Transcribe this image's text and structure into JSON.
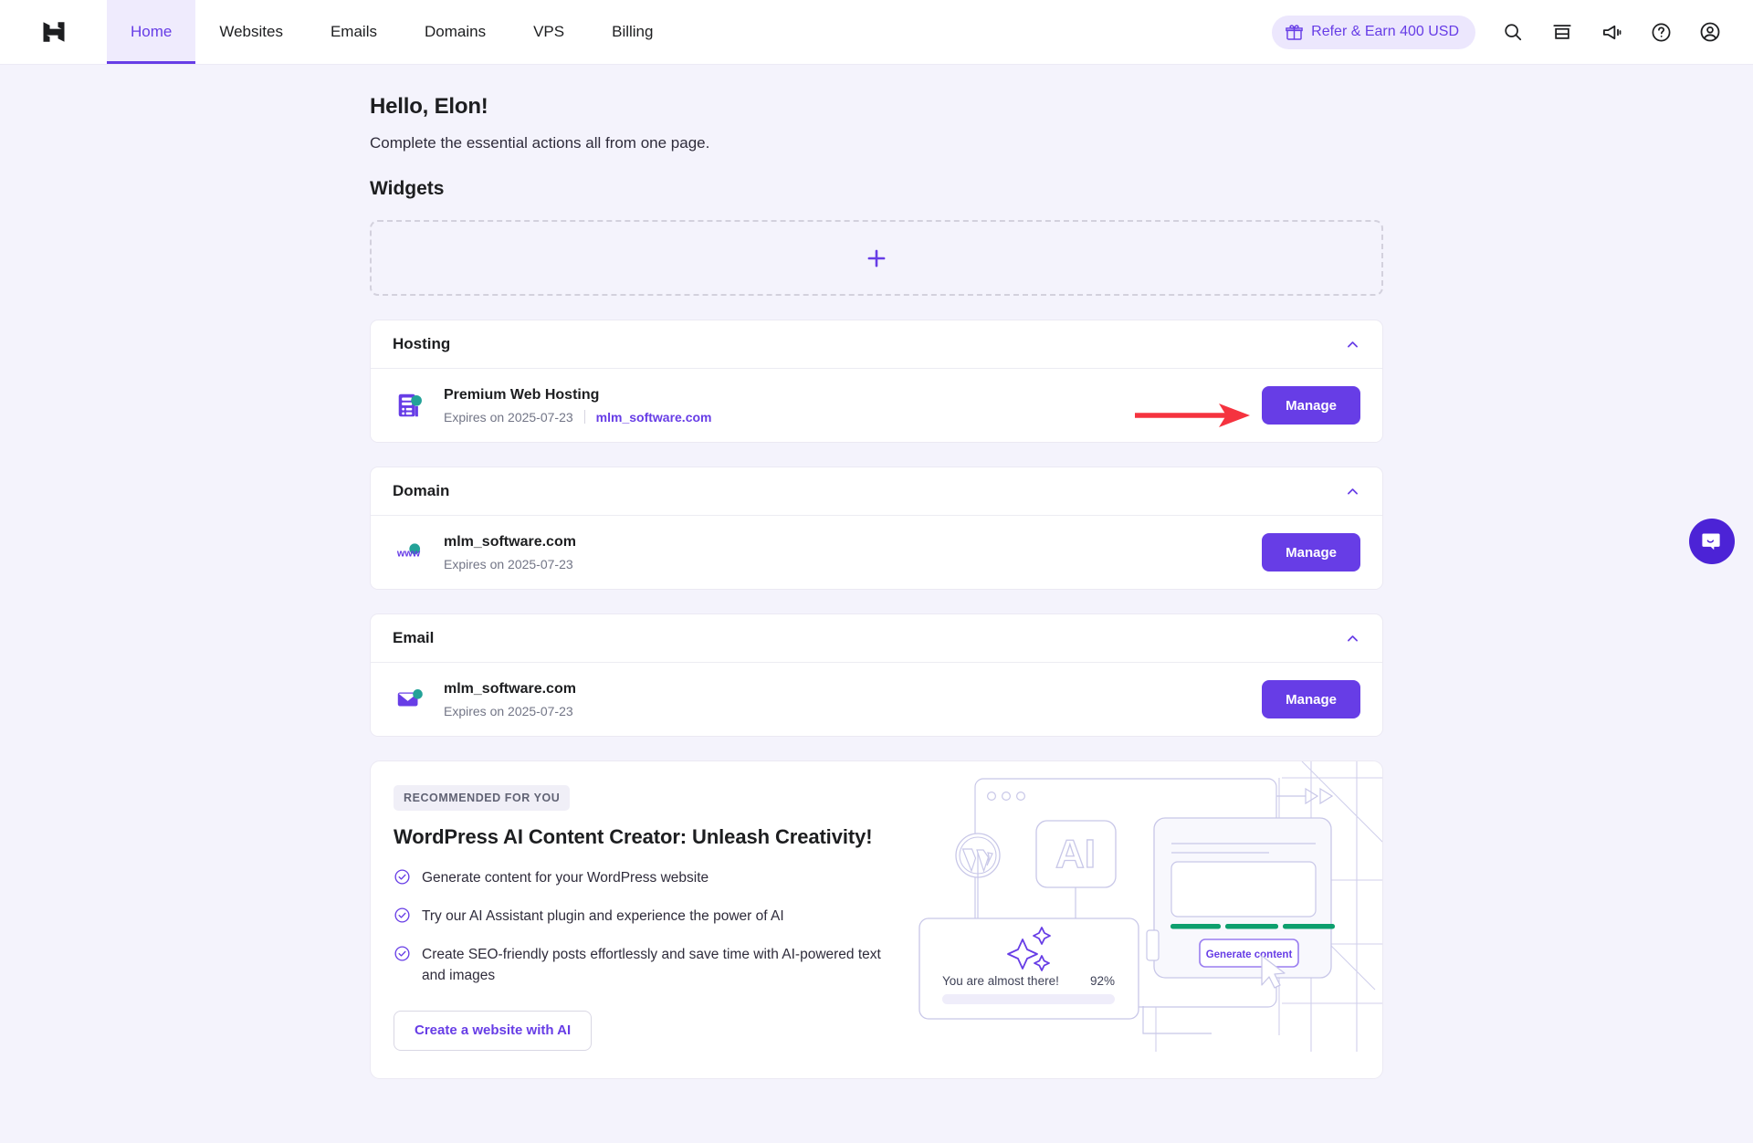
{
  "header": {
    "logo": "hostinger-logo",
    "nav": [
      {
        "label": "Home",
        "active": true
      },
      {
        "label": "Websites",
        "active": false
      },
      {
        "label": "Emails",
        "active": false
      },
      {
        "label": "Domains",
        "active": false
      },
      {
        "label": "VPS",
        "active": false
      },
      {
        "label": "Billing",
        "active": false
      }
    ],
    "refer": {
      "label": "Refer & Earn 400 USD",
      "icon": "gift-icon"
    },
    "icons": [
      "search-icon",
      "store-icon",
      "megaphone-icon",
      "help-icon",
      "account-icon"
    ]
  },
  "greeting": {
    "title": "Hello, Elon!",
    "subtitle": "Complete the essential actions all from one page."
  },
  "widgets": {
    "heading": "Widgets",
    "add_label": "+"
  },
  "sections": [
    {
      "key": "hosting",
      "title": "Hosting",
      "collapse_icon": "chevron-up-icon",
      "icon": "server-icon",
      "item_title": "Premium Web Hosting",
      "expires": "Expires on 2025-07-23",
      "domain": "mlm_software.com",
      "button": "Manage"
    },
    {
      "key": "domain",
      "title": "Domain",
      "collapse_icon": "chevron-up-icon",
      "icon": "www-icon",
      "item_title": "mlm_software.com",
      "expires": "Expires on 2025-07-23",
      "domain": "",
      "button": "Manage"
    },
    {
      "key": "email",
      "title": "Email",
      "collapse_icon": "chevron-up-icon",
      "icon": "envelope-icon",
      "item_title": "mlm_software.com",
      "expires": "Expires on 2025-07-23",
      "domain": "",
      "button": "Manage"
    }
  ],
  "recommended": {
    "badge": "RECOMMENDED FOR YOU",
    "title": "WordPress AI Content Creator: Unleash Creativity!",
    "bullets": [
      "Generate content for your WordPress website",
      "Try our AI Assistant plugin and experience the power of AI",
      "Create SEO-friendly posts effortlessly and save time with AI-powered text and images"
    ],
    "cta": "Create a website with AI",
    "illustration": {
      "ai_label": "AI",
      "wordpress_label": "wordpress-logo",
      "progress_text": "You are almost there!",
      "progress_percent": "92%",
      "generate_button": "Generate content"
    }
  },
  "annotation": {
    "arrow": "red-arrow-pointing-to-manage"
  },
  "chat": {
    "label": "intercom-launcher"
  },
  "colors": {
    "brand_purple": "#673de6",
    "brand_purple_dark": "#4c23d6",
    "page_bg": "#f4f3fc",
    "accent_teal": "#23a298",
    "accent_green": "#0d9f6e",
    "annotation_red": "#f5333f"
  }
}
